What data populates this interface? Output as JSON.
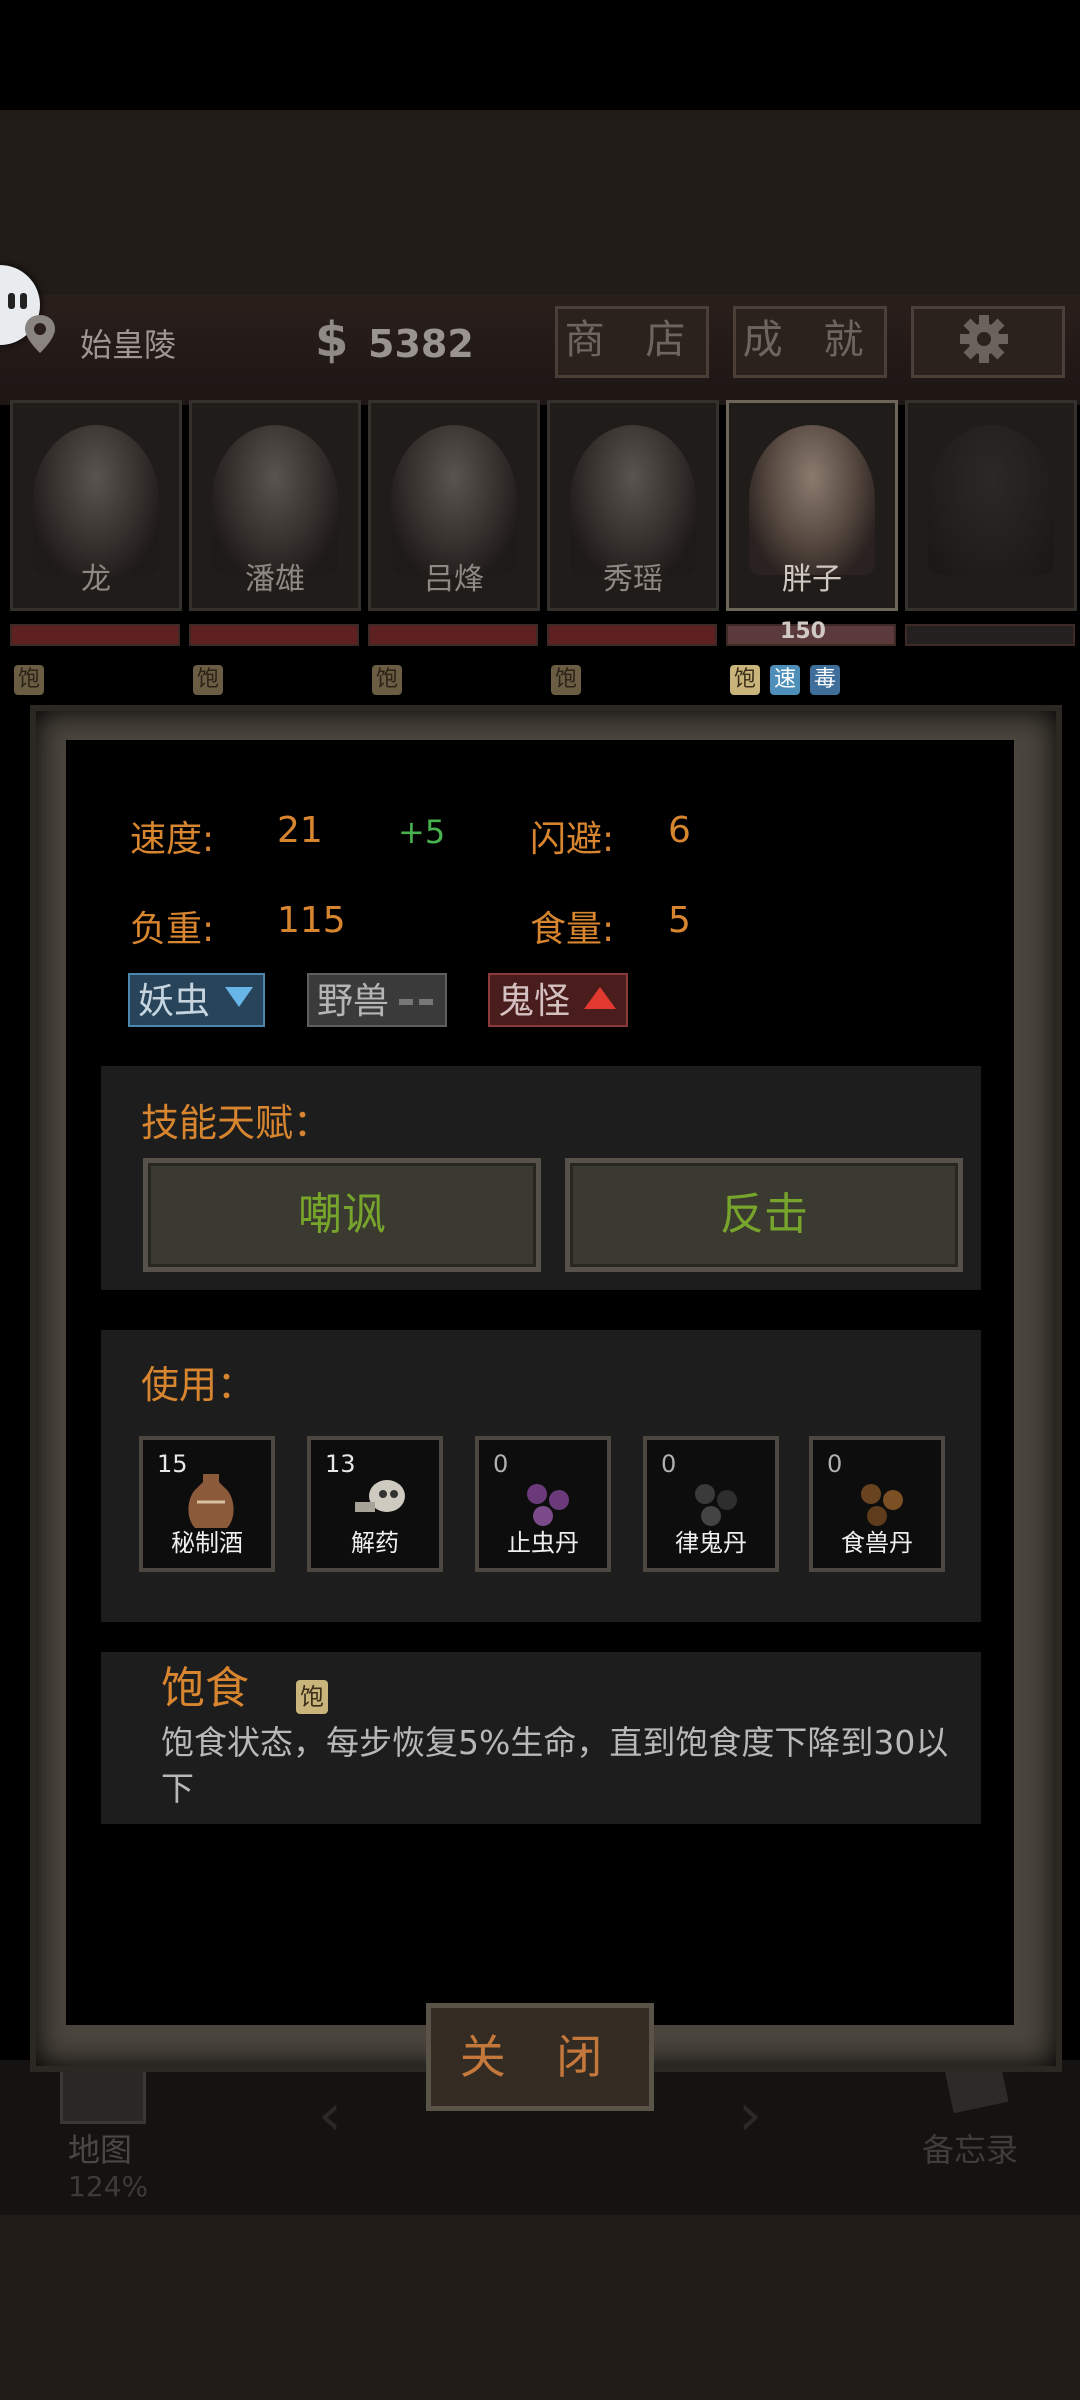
{
  "location": "始皇陵",
  "currency_symbol": "$",
  "money": "5382",
  "top_buttons": {
    "shop": "商 店",
    "achievements": "成 就"
  },
  "team": [
    {
      "name": "龙",
      "badges": [
        "饱"
      ]
    },
    {
      "name": "潘雄",
      "badges": [
        "饱"
      ]
    },
    {
      "name": "吕烽",
      "badges": [
        "饱"
      ]
    },
    {
      "name": "秀瑶",
      "badges": [
        "饱"
      ]
    },
    {
      "name": "胖子",
      "badges": [
        "饱",
        "速",
        "毒"
      ],
      "hp": "150"
    }
  ],
  "stats": {
    "speed_label": "速度:",
    "speed_value": "21",
    "speed_bonus": "+5",
    "dodge_label": "闪避:",
    "dodge_value": "6",
    "load_label": "负重:",
    "load_value": "115",
    "food_label": "食量:",
    "food_value": "5"
  },
  "resistances": {
    "insect": "妖虫",
    "beast": "野兽",
    "ghost": "鬼怪"
  },
  "skills": {
    "title": "技能天赋：",
    "skill1": "嘲讽",
    "skill2": "反击"
  },
  "use": {
    "title": "使用：",
    "items": [
      {
        "count": "15",
        "name": "秘制酒"
      },
      {
        "count": "13",
        "name": "解药"
      },
      {
        "count": "0",
        "name": "止虫丹"
      },
      {
        "count": "0",
        "name": "律鬼丹"
      },
      {
        "count": "0",
        "name": "食兽丹"
      }
    ]
  },
  "status": {
    "title": "饱食",
    "badge": "饱",
    "description": "饱食状态，每步恢复5%生命，直到饱食度下降到30以下"
  },
  "close_label": "关 闭",
  "bottom": {
    "map_label": "地图",
    "map_zoom": "124%",
    "memo_label": "备忘录"
  }
}
